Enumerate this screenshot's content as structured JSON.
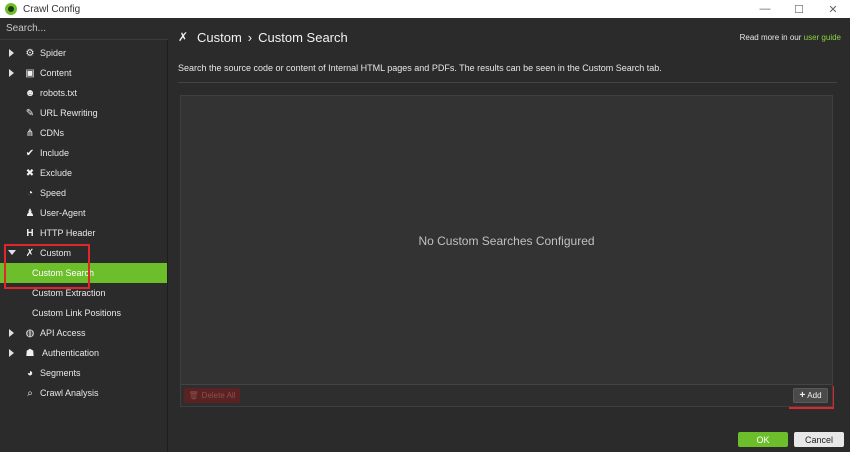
{
  "window": {
    "title": "Crawl Config",
    "controls": [
      "—",
      "☐",
      "✕"
    ]
  },
  "sidebar": {
    "search_placeholder": "Search...",
    "items": [
      {
        "label": "Spider",
        "icon": "gear-icon",
        "expandable": true
      },
      {
        "label": "Content",
        "icon": "content-icon",
        "expandable": true
      },
      {
        "label": "robots.txt",
        "icon": "robot-icon"
      },
      {
        "label": "URL Rewriting",
        "icon": "edit-icon"
      },
      {
        "label": "CDNs",
        "icon": "network-icon"
      },
      {
        "label": "Include",
        "icon": "check-circle-icon"
      },
      {
        "label": "Exclude",
        "icon": "x-circle-icon"
      },
      {
        "label": "Speed",
        "icon": "speedometer-icon"
      },
      {
        "label": "User-Agent",
        "icon": "user-agent-icon"
      },
      {
        "label": "HTTP Header",
        "icon": "header-icon"
      },
      {
        "label": "Custom",
        "icon": "tools-icon",
        "expanded": true
      },
      {
        "label": "Custom Search",
        "selected": true
      },
      {
        "label": "Custom Extraction"
      },
      {
        "label": "Custom Link Positions"
      },
      {
        "label": "API Access",
        "icon": "globe-icon",
        "expandable": true
      },
      {
        "label": "Authentication",
        "icon": "users-lock-icon",
        "expandable": true
      },
      {
        "label": "Segments",
        "icon": "pie-chart-icon"
      },
      {
        "label": "Crawl Analysis",
        "icon": "search-icon"
      }
    ]
  },
  "header": {
    "breadcrumb_parent": "Custom",
    "breadcrumb_separator": "›",
    "breadcrumb_current": "Custom Search",
    "read_more_prefix": "Read more in our",
    "read_more_link": "user guide"
  },
  "description": "Search the source code or content of Internal HTML pages and PDFs. The results can be seen in the Custom Search tab.",
  "panel": {
    "empty_message": "No Custom Searches Configured",
    "delete_all_label": "Delete All",
    "add_label": "Add"
  },
  "footer": {
    "ok_label": "OK",
    "cancel_label": "Cancel"
  },
  "colors": {
    "accent": "#6cbf2b",
    "highlight": "#e0262d",
    "background": "#2b2b2b"
  }
}
